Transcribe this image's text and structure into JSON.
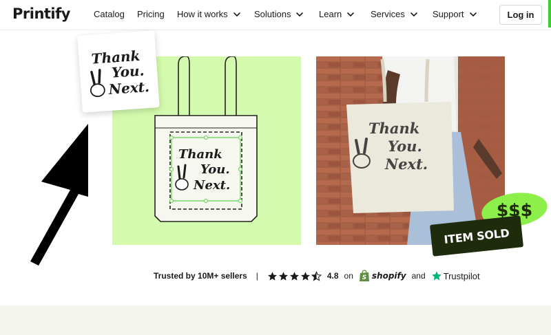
{
  "brand": {
    "logo": "Printify"
  },
  "nav": {
    "items": [
      {
        "label": "Catalog",
        "has_dropdown": false
      },
      {
        "label": "Pricing",
        "has_dropdown": false
      },
      {
        "label": "How it works",
        "has_dropdown": true
      },
      {
        "label": "Solutions",
        "has_dropdown": true
      },
      {
        "label": "Learn",
        "has_dropdown": true
      },
      {
        "label": "Services",
        "has_dropdown": true
      },
      {
        "label": "Support",
        "has_dropdown": true
      }
    ],
    "login_label": "Log in"
  },
  "hero": {
    "design_text": [
      "Thank",
      "You.",
      "Next."
    ],
    "money_badge": "$$$",
    "sold_badge": "ITEM SOLD"
  },
  "trust": {
    "sellers_label": "Trusted by 10M+ sellers",
    "separator": "|",
    "rating_value": "4.8",
    "stars_full": 4,
    "stars_half": 1,
    "on_label": "on",
    "shopify_label": "shopify",
    "and_label": "and",
    "trustpilot_label": "Trustpilot"
  },
  "colors": {
    "accent_green": "#d4fbad",
    "brand_green": "#3ccf2f",
    "dark_green": "#1f2b0d",
    "money_green": "#8df04a"
  }
}
